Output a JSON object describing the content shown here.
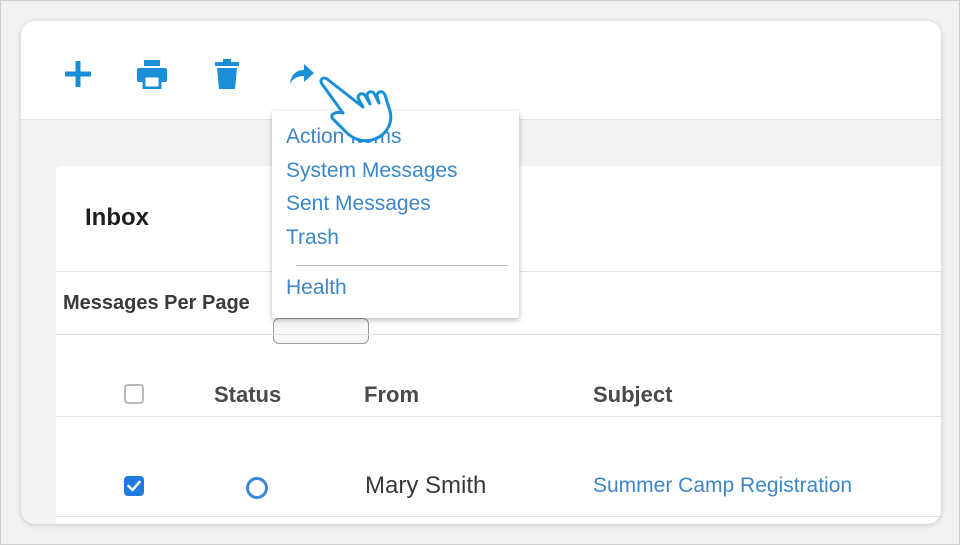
{
  "colors": {
    "accent": "#1a8fd8",
    "link": "#3c86c9",
    "checkbox": "#1f7ae0"
  },
  "toolbar": {
    "icons": [
      "plus-icon",
      "print-icon",
      "trash-icon",
      "forward-arrow-icon"
    ]
  },
  "inbox": {
    "title": "Inbox",
    "messages_per_page_label": "Messages Per Page"
  },
  "table": {
    "headers": [
      "Status",
      "From",
      "Subject"
    ],
    "rows": [
      {
        "checked": true,
        "status": "unread",
        "from": "Mary Smith",
        "subject": "Summer Camp Registration"
      }
    ]
  },
  "menu": {
    "items": [
      "Action Items",
      "System Messages",
      "Sent Messages",
      "Trash"
    ],
    "extra_item": "Health"
  }
}
